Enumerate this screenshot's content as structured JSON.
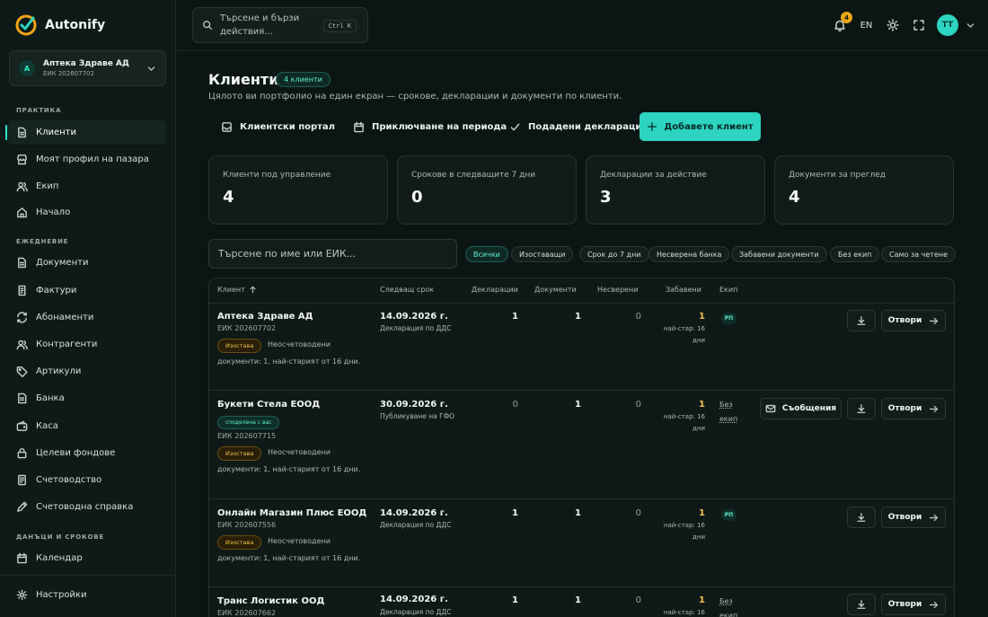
{
  "app": {
    "name": "Autonify"
  },
  "org": {
    "initial": "A",
    "name": "Аптека Здраве АД",
    "eik": "ЕИК 202607702"
  },
  "sidebar": {
    "sections": {
      "practice": "ПРАКТИКА",
      "daily": "ЕЖЕДНЕВИЕ",
      "taxes": "ДАНЪЦИ И СРОКОВЕ"
    },
    "items": [
      {
        "label": "Клиенти",
        "icon": "file-icon"
      },
      {
        "label": "Моят профил на пазара",
        "icon": "store-icon"
      },
      {
        "label": "Екип",
        "icon": "users-icon"
      },
      {
        "label": "Начало",
        "icon": "home-icon"
      },
      {
        "label": "Документи",
        "icon": "file-icon"
      },
      {
        "label": "Фактури",
        "icon": "receipt-icon"
      },
      {
        "label": "Абонаменти",
        "icon": "repeat-icon"
      },
      {
        "label": "Контрагенти",
        "icon": "users-icon"
      },
      {
        "label": "Артикули",
        "icon": "tag-icon"
      },
      {
        "label": "Банка",
        "icon": "bank-icon"
      },
      {
        "label": "Каса",
        "icon": "wallet-icon"
      },
      {
        "label": "Целеви фондове",
        "icon": "lock-icon"
      },
      {
        "label": "Счетоводство",
        "icon": "ledger-icon"
      },
      {
        "label": "Счетоводна справка",
        "icon": "pencil-icon"
      },
      {
        "label": "Календар",
        "icon": "calendar-icon"
      },
      {
        "label": "Настройки",
        "icon": "gear-icon"
      }
    ]
  },
  "topbar": {
    "search_text": "Търсене и бързи действия...",
    "shortcut": "Ctrl K",
    "notif_count": "4",
    "lang": "EN",
    "avatar": "TT"
  },
  "page": {
    "title": "Клиенти",
    "badge": "4 клиенти",
    "subtitle": "Цялото ви портфолио на един екран — срокове, декларации и документи по клиенти.",
    "actions": {
      "portal": "Клиентски портал",
      "close_period": "Приключване на периода",
      "filed": "Подадени декларации",
      "add": "Добавете клиент"
    }
  },
  "stats": [
    {
      "label": "Клиенти под управление",
      "value": "4"
    },
    {
      "label": "Срокове в следващите 7 дни",
      "value": "0"
    },
    {
      "label": "Декларации за действие",
      "value": "3"
    },
    {
      "label": "Документи за преглед",
      "value": "4"
    }
  ],
  "filters": {
    "search_placeholder": "Търсене по име или ЕИК...",
    "chips": [
      "Всички",
      "Изоставащи",
      "Срок до 7 дни",
      "Несверена банка",
      "Забавени документи",
      "Без екип",
      "Само за четене"
    ]
  },
  "table": {
    "headers": {
      "client": "Клиент",
      "next": "Следващ срок",
      "decl": "Декларации",
      "docs": "Документи",
      "unrec": "Несверени",
      "late": "Забавени",
      "team": "Екип"
    },
    "rows": [
      {
        "name": "Аптека Здраве АД",
        "eik": "ЕИК 202607702",
        "tag": "Изостава",
        "note1": "Неосчетоводени",
        "note2": "документи: 1, най-старият от 16 дни.",
        "date": "14.09.2026 г.",
        "dtype": "Декларация по ДДС",
        "decl": "1",
        "docs": "1",
        "unrec": "0",
        "late": "1",
        "old": "най-стар: 16 дни",
        "team": "РП",
        "open": "Отвори"
      },
      {
        "name": "Букети Стела ЕООД",
        "shared": "споделена с вас",
        "eik": "ЕИК 202607715",
        "tag": "Изостава",
        "note1": "Неосчетоводени",
        "note2": "документи: 1, най-старият от 16 дни.",
        "date": "30.09.2026 г.",
        "dtype": "Публикуване на ГФО",
        "decl": "0",
        "docs": "1",
        "unrec": "0",
        "late": "1",
        "old": "най-стар: 16 дни",
        "team": "Без екип",
        "msg": "Съобщения",
        "open": "Отвори"
      },
      {
        "name": "Онлайн Магазин Плюс ЕООД",
        "eik": "ЕИК 202607556",
        "tag": "Изостава",
        "note1": "Неосчетоводени",
        "note2": "документи: 1, най-старият от 16 дни.",
        "date": "14.09.2026 г.",
        "dtype": "Декларация по ДДС",
        "decl": "1",
        "docs": "1",
        "unrec": "0",
        "late": "1",
        "old": "най-стар: 16 дни",
        "team": "РП",
        "open": "Отвори"
      },
      {
        "name": "Транс Логистик ООД",
        "eik": "ЕИК 202607662",
        "date": "14.09.2026 г.",
        "dtype": "Декларация по ДДС",
        "decl": "1",
        "docs": "1",
        "unrec": "0",
        "late": "1",
        "old": "най-стар: 16",
        "team": "Без екип",
        "open": "Отвори"
      }
    ]
  },
  "colors": {
    "accent": "#2dd4bf",
    "background": "#0b1614",
    "warning": "#f2c14a"
  }
}
